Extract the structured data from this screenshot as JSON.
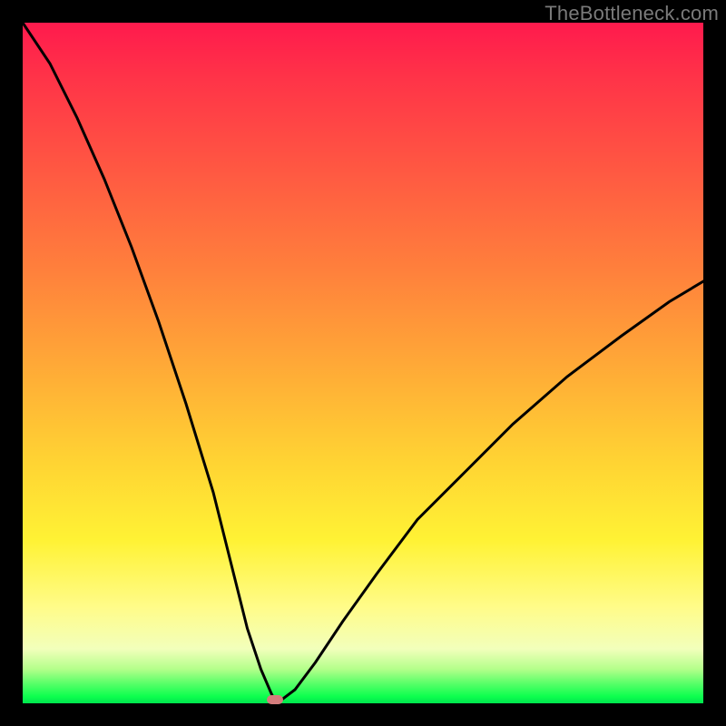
{
  "watermark": "TheBottleneck.com",
  "colors": {
    "frame": "#000000",
    "curve": "#000000",
    "marker": "#d47c7c",
    "gradient_stops": [
      "#ff1a4d",
      "#ff3348",
      "#ff5942",
      "#ff7f3c",
      "#ffa837",
      "#ffd233",
      "#fff234",
      "#fffc8a",
      "#f2ffbb",
      "#b3ff8a",
      "#5cff6a",
      "#0dff4e",
      "#00e54e"
    ]
  },
  "chart_data": {
    "type": "line",
    "title": "",
    "xlabel": "",
    "ylabel": "",
    "xlim": [
      0,
      100
    ],
    "ylim": [
      0,
      100
    ],
    "x_min_frac": 0.37,
    "series": [
      {
        "name": "bottleneck_curve_left",
        "x": [
          0,
          4,
          8,
          12,
          16,
          20,
          24,
          28,
          31,
          33,
          35,
          36.5,
          37
        ],
        "values": [
          100,
          94,
          86,
          77,
          67,
          56,
          44,
          31,
          19,
          11,
          5,
          1.5,
          0.5
        ]
      },
      {
        "name": "bottleneck_curve_right",
        "x": [
          38,
          40,
          43,
          47,
          52,
          58,
          65,
          72,
          80,
          88,
          95,
          100
        ],
        "values": [
          0.5,
          2,
          6,
          12,
          19,
          27,
          34,
          41,
          48,
          54,
          59,
          62
        ]
      }
    ],
    "marker": {
      "x": 37,
      "y": 0.5
    }
  }
}
